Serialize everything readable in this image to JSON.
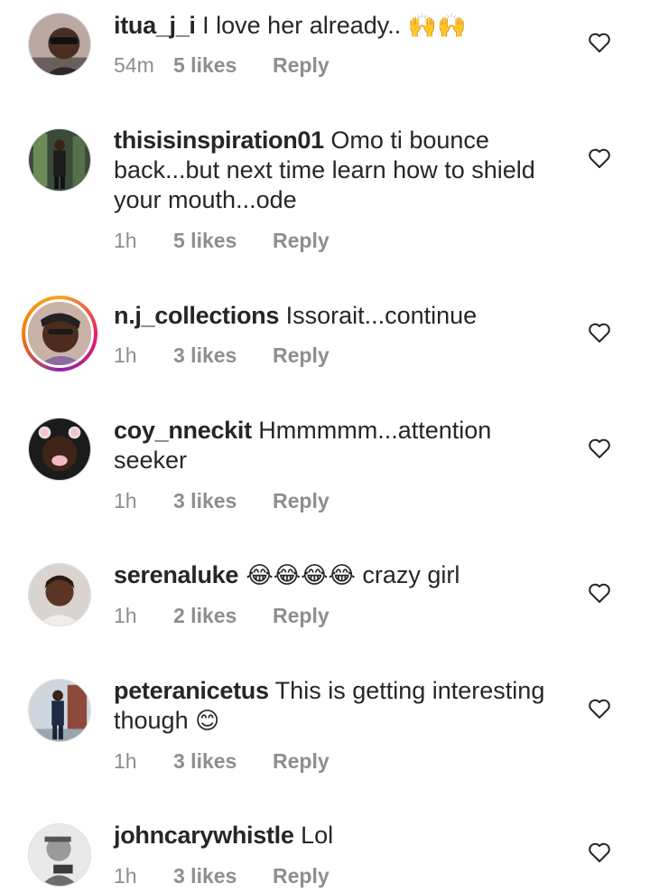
{
  "comments": [
    {
      "username": "itua_j_i",
      "text": " I love her already.. ",
      "emoji": "🙌🙌",
      "time": "54m",
      "likes": "5 likes",
      "reply": "Reply"
    },
    {
      "username": "thisisinspiration01",
      "text": " Omo ti bounce back...but next time learn how to shield your mouth...ode",
      "emoji": "",
      "time": "1h",
      "likes": "5 likes",
      "reply": "Reply"
    },
    {
      "username": "n.j_collections",
      "text": " Issorait...continue",
      "emoji": "",
      "time": "1h",
      "likes": "3 likes",
      "reply": "Reply"
    },
    {
      "username": "coy_nneckit",
      "text": " Hmmmmm...attention seeker",
      "emoji": "",
      "time": "1h",
      "likes": "3 likes",
      "reply": "Reply"
    },
    {
      "username": "serenaluke",
      "text": " crazy girl",
      "emoji": " 😂😂😂😂",
      "time": "1h",
      "likes": "2 likes",
      "reply": "Reply"
    },
    {
      "username": "peteranicetus",
      "text": " This is getting interesting though ",
      "emoji": "😊",
      "time": "1h",
      "likes": "3 likes",
      "reply": "Reply"
    },
    {
      "username": "johncarywhistle",
      "text": " Lol",
      "emoji": "",
      "time": "1h",
      "likes": "3 likes",
      "reply": "Reply"
    }
  ],
  "colors": {
    "text": "#262626",
    "meta": "#8e8e8e",
    "story_ring": "#e91e63"
  },
  "icons": {
    "like": "heart-outline-icon"
  }
}
